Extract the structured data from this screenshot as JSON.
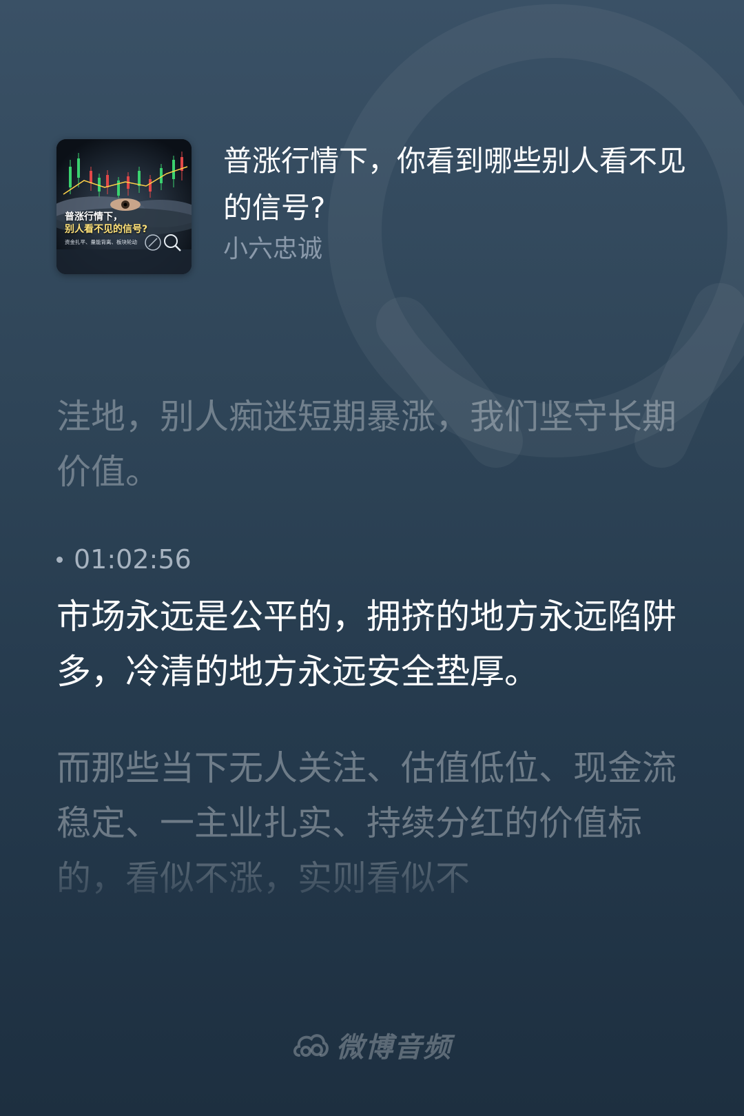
{
  "episode": {
    "title": "普涨行情下，你看到哪些别人看不见的信号?",
    "author": "小六忠诚"
  },
  "cover": {
    "title_line1": "普涨行情下，",
    "title_line2": "别人看不见的信号?",
    "subtitle": "资金扎平、量能背离、板块轮动"
  },
  "transcript": {
    "previous": "洼地，别人痴迷短期暴涨，我们坚守长期价值。",
    "timestamp": "01:02:56",
    "current": "市场永远是公平的，拥挤的地方永远陷阱多，冷清的地方永远安全垫厚。",
    "next": "而那些当下无人关注、估值低位、现金流稳定、一主业扎实、持续分红的价值标的，看似不涨，实则看似不"
  },
  "brand": {
    "name": "微博音频",
    "icon": "weibo-cloud-icon"
  },
  "colors": {
    "background_top": "#3a5166",
    "background_bottom": "#1d2f40",
    "text_primary": "#ffffff",
    "text_secondary": "#8b9aab"
  }
}
